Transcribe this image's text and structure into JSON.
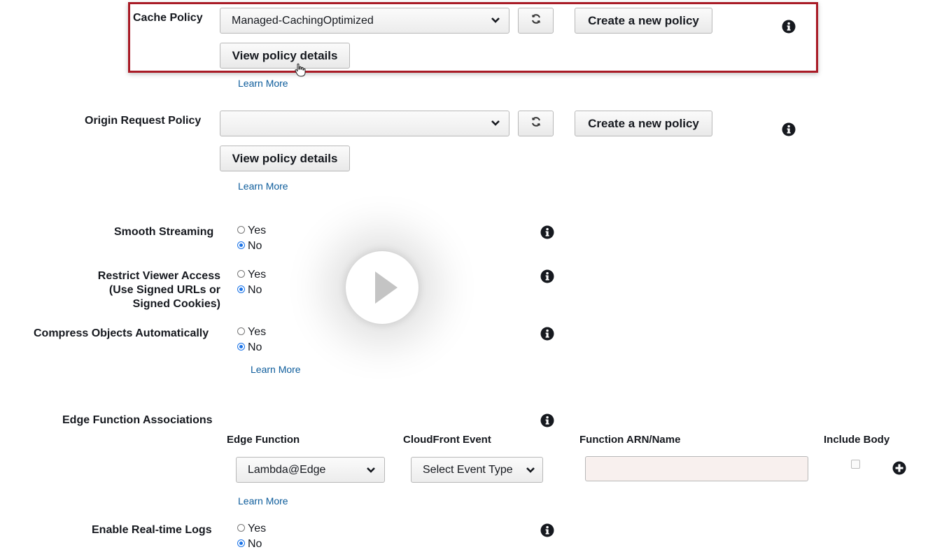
{
  "cache_policy": {
    "label": "Cache Policy",
    "selected": "Managed-CachingOptimized",
    "create_label": "Create a new policy",
    "view_label": "View policy details",
    "learn_more": "Learn More"
  },
  "origin_request_policy": {
    "label": "Origin Request Policy",
    "selected": "",
    "create_label": "Create a new policy",
    "view_label": "View policy details",
    "learn_more": "Learn More"
  },
  "smooth_streaming": {
    "label": "Smooth Streaming",
    "yes": "Yes",
    "no": "No",
    "value": "No"
  },
  "restrict_viewer": {
    "label_lines": [
      "Restrict Viewer Access",
      "(Use Signed URLs or",
      "Signed Cookies)"
    ],
    "yes": "Yes",
    "no": "No",
    "value": "No"
  },
  "compress": {
    "label": "Compress Objects Automatically",
    "yes": "Yes",
    "no": "No",
    "value": "No",
    "learn_more": "Learn More"
  },
  "edge": {
    "label": "Edge Function Associations",
    "columns": [
      "Edge Function",
      "CloudFront Event",
      "Function ARN/Name",
      "Include Body"
    ],
    "function_type": "Lambda@Edge",
    "event_placeholder": "Select Event Type",
    "learn_more": "Learn More"
  },
  "realtime_logs": {
    "label": "Enable Real-time Logs",
    "yes": "Yes",
    "no": "No",
    "value": "No"
  },
  "colors": {
    "highlight": "#a91b26",
    "link": "#0d5c9b",
    "radio_selected": "#1a73e8"
  },
  "icons": [
    "info-icon",
    "refresh-icon",
    "chevron-down-icon",
    "add-icon",
    "play-icon",
    "hand-cursor-icon"
  ]
}
